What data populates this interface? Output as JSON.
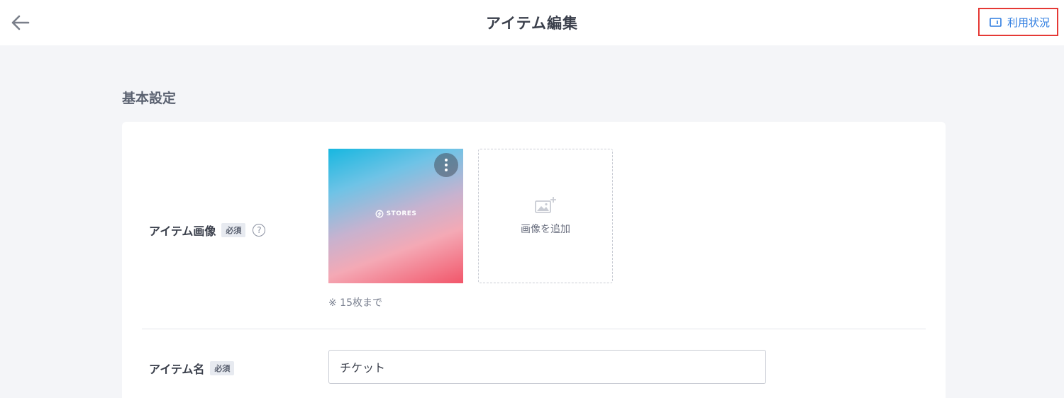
{
  "header": {
    "title": "アイテム編集",
    "usage_label": "利用状況"
  },
  "section": {
    "title": "基本設定"
  },
  "item_image": {
    "label": "アイテム画像",
    "required_badge": "必須",
    "help_symbol": "?",
    "thumbnail_logo_text": "STORES",
    "add_label": "画像を追加",
    "note": "※ 15枚まで"
  },
  "item_name": {
    "label": "アイテム名",
    "required_badge": "必須",
    "value": "チケット"
  },
  "colors": {
    "accent": "#2f7de1",
    "highlight_border": "#e53935"
  }
}
